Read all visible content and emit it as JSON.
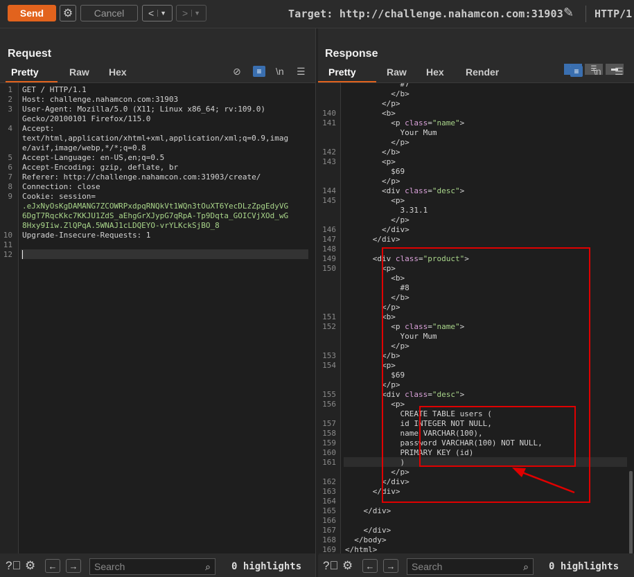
{
  "toolbar": {
    "send_label": "Send",
    "cancel_label": "Cancel",
    "back_label": "<",
    "forward_label": ">",
    "target_label": "Target: http://challenge.nahamcon.com:31903",
    "http_version": "HTTP/1"
  },
  "request": {
    "title": "Request",
    "tabs": [
      "Pretty",
      "Raw",
      "Hex"
    ],
    "active_tab": "Pretty",
    "lines": [
      {
        "n": "1",
        "t": "GET / HTTP/1.1"
      },
      {
        "n": "2",
        "t": "Host: challenge.nahamcon.com:31903"
      },
      {
        "n": "3",
        "t": "User-Agent: Mozilla/5.0 (X11; Linux x86_64; rv:109.0)"
      },
      {
        "n": "",
        "t": "Gecko/20100101 Firefox/115.0"
      },
      {
        "n": "4",
        "t": "Accept:"
      },
      {
        "n": "",
        "t": "text/html,application/xhtml+xml,application/xml;q=0.9,imag"
      },
      {
        "n": "",
        "t": "e/avif,image/webp,*/*;q=0.8"
      },
      {
        "n": "5",
        "t": "Accept-Language: en-US,en;q=0.5"
      },
      {
        "n": "6",
        "t": "Accept-Encoding: gzip, deflate, br"
      },
      {
        "n": "7",
        "t": "Referer: http://challenge.nahamcon.com:31903/create/"
      },
      {
        "n": "8",
        "t": "Connection: close"
      },
      {
        "n": "9",
        "t": "Cookie: session="
      },
      {
        "n": "",
        "t": ".eJxNyOsKgDAMANG7ZCOWRPxdpqRNQkVt1WQn3tOuXT6YecDLzZpgEdyVG",
        "c": 1
      },
      {
        "n": "",
        "t": "6DgT7RqcKkc7KKJU1ZdS_aEhgGrXJypG7qRpA-Tp9Dqta_GOICVjXOd_wG",
        "c": 1
      },
      {
        "n": "",
        "t": "8Hxy9Iiw.ZlQPqA.5WNAJ1cLDQEYO-vrYLKckSjBO_8",
        "c": 1
      },
      {
        "n": "10",
        "t": "Upgrade-Insecure-Requests: 1"
      },
      {
        "n": "11",
        "t": ""
      },
      {
        "n": "12",
        "t": ""
      }
    ],
    "search_placeholder": "Search",
    "highlights": "0 highlights"
  },
  "response": {
    "title": "Response",
    "tabs": [
      "Pretty",
      "Raw",
      "Hex",
      "Render"
    ],
    "active_tab": "Pretty",
    "lines": [
      {
        "n": "",
        "t": "            #7"
      },
      {
        "n": "",
        "t": "          </b>"
      },
      {
        "n": "",
        "t": "        </p>"
      },
      {
        "n": "140",
        "t": "        <b>"
      },
      {
        "n": "141",
        "t": "          <p class=\"name\">"
      },
      {
        "n": "",
        "t": "            Your Mum"
      },
      {
        "n": "",
        "t": "          </p>"
      },
      {
        "n": "142",
        "t": "        </b>"
      },
      {
        "n": "143",
        "t": "        <p>"
      },
      {
        "n": "",
        "t": "          $69"
      },
      {
        "n": "",
        "t": "        </p>"
      },
      {
        "n": "144",
        "t": "        <div class=\"desc\">"
      },
      {
        "n": "145",
        "t": "          <p>"
      },
      {
        "n": "",
        "t": "            3.31.1"
      },
      {
        "n": "",
        "t": "          </p>"
      },
      {
        "n": "146",
        "t": "        </div>"
      },
      {
        "n": "147",
        "t": "      </div>"
      },
      {
        "n": "148",
        "t": ""
      },
      {
        "n": "149",
        "t": "      <div class=\"product\">"
      },
      {
        "n": "150",
        "t": "        <p>"
      },
      {
        "n": "",
        "t": "          <b>"
      },
      {
        "n": "",
        "t": "            #8"
      },
      {
        "n": "",
        "t": "          </b>"
      },
      {
        "n": "",
        "t": "        </p>"
      },
      {
        "n": "151",
        "t": "        <b>"
      },
      {
        "n": "152",
        "t": "          <p class=\"name\">"
      },
      {
        "n": "",
        "t": "            Your Mum"
      },
      {
        "n": "",
        "t": "          </p>"
      },
      {
        "n": "153",
        "t": "        </b>"
      },
      {
        "n": "154",
        "t": "        <p>"
      },
      {
        "n": "",
        "t": "          $69"
      },
      {
        "n": "",
        "t": "        </p>"
      },
      {
        "n": "155",
        "t": "        <div class=\"desc\">"
      },
      {
        "n": "156",
        "t": "          <p>"
      },
      {
        "n": "",
        "t": "            CREATE TABLE users ("
      },
      {
        "n": "157",
        "t": "            id INTEGER NOT NULL,"
      },
      {
        "n": "158",
        "t": "            name VARCHAR(100),"
      },
      {
        "n": "159",
        "t": "            password VARCHAR(100) NOT NULL,"
      },
      {
        "n": "160",
        "t": "            PRIMARY KEY (id)"
      },
      {
        "n": "161",
        "t": "            )"
      },
      {
        "n": "",
        "t": "          </p>"
      },
      {
        "n": "162",
        "t": "        </div>"
      },
      {
        "n": "163",
        "t": "      </div>"
      },
      {
        "n": "164",
        "t": ""
      },
      {
        "n": "165",
        "t": "    </div>"
      },
      {
        "n": "166",
        "t": ""
      },
      {
        "n": "167",
        "t": "    </div>"
      },
      {
        "n": "168",
        "t": "  </body>"
      },
      {
        "n": "169",
        "t": "</html>"
      }
    ],
    "search_placeholder": "Search",
    "highlights": "0 highlights"
  }
}
